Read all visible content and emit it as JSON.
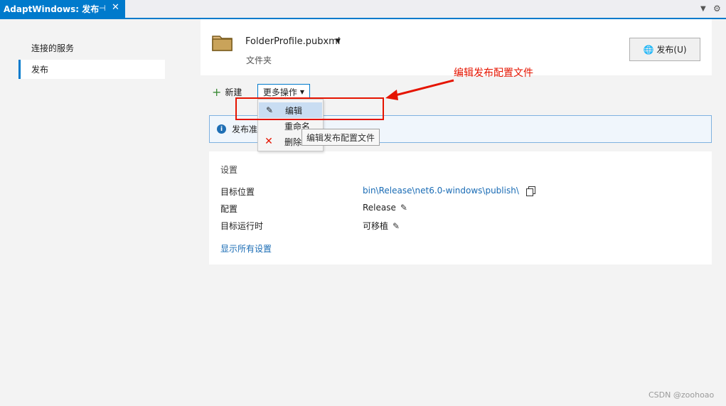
{
  "tab": {
    "title": "AdaptWindows: 发布",
    "pin_icon": "pin-icon",
    "close_icon": "close-icon"
  },
  "strip": {
    "dropdown_icon": "chevron-down-icon",
    "gear_icon": "gear-icon"
  },
  "nav": {
    "items": [
      {
        "label": "连接的服务"
      },
      {
        "label": "发布",
        "selected": true
      }
    ]
  },
  "profile": {
    "name": "FolderProfile.pubxml",
    "type": "文件夹",
    "publish_label": "发布(U)"
  },
  "toolbar": {
    "new_label": "新建",
    "more_label": "更多操作"
  },
  "info": {
    "text": "发布准"
  },
  "menu": {
    "items": [
      {
        "label": "编辑",
        "icon": "pencil-icon"
      },
      {
        "label": "重命名",
        "icon": ""
      },
      {
        "label": "删除",
        "icon": "delete-x-icon"
      }
    ]
  },
  "tooltip": "编辑发布配置文件",
  "settings": {
    "header": "设置",
    "rows": [
      {
        "label": "目标位置",
        "value": "bin\\Release\\net6.0-windows\\publish\\"
      },
      {
        "label": "配置",
        "value": "Release"
      },
      {
        "label": "目标运行时",
        "value": "可移植"
      }
    ],
    "show_all": "显示所有设置"
  },
  "annotation": {
    "text": "编辑发布配置文件",
    "color": "#e51400"
  },
  "watermark": "CSDN @zoohoao",
  "colors": {
    "accent": "#007acc",
    "link": "#1a6cb5"
  }
}
